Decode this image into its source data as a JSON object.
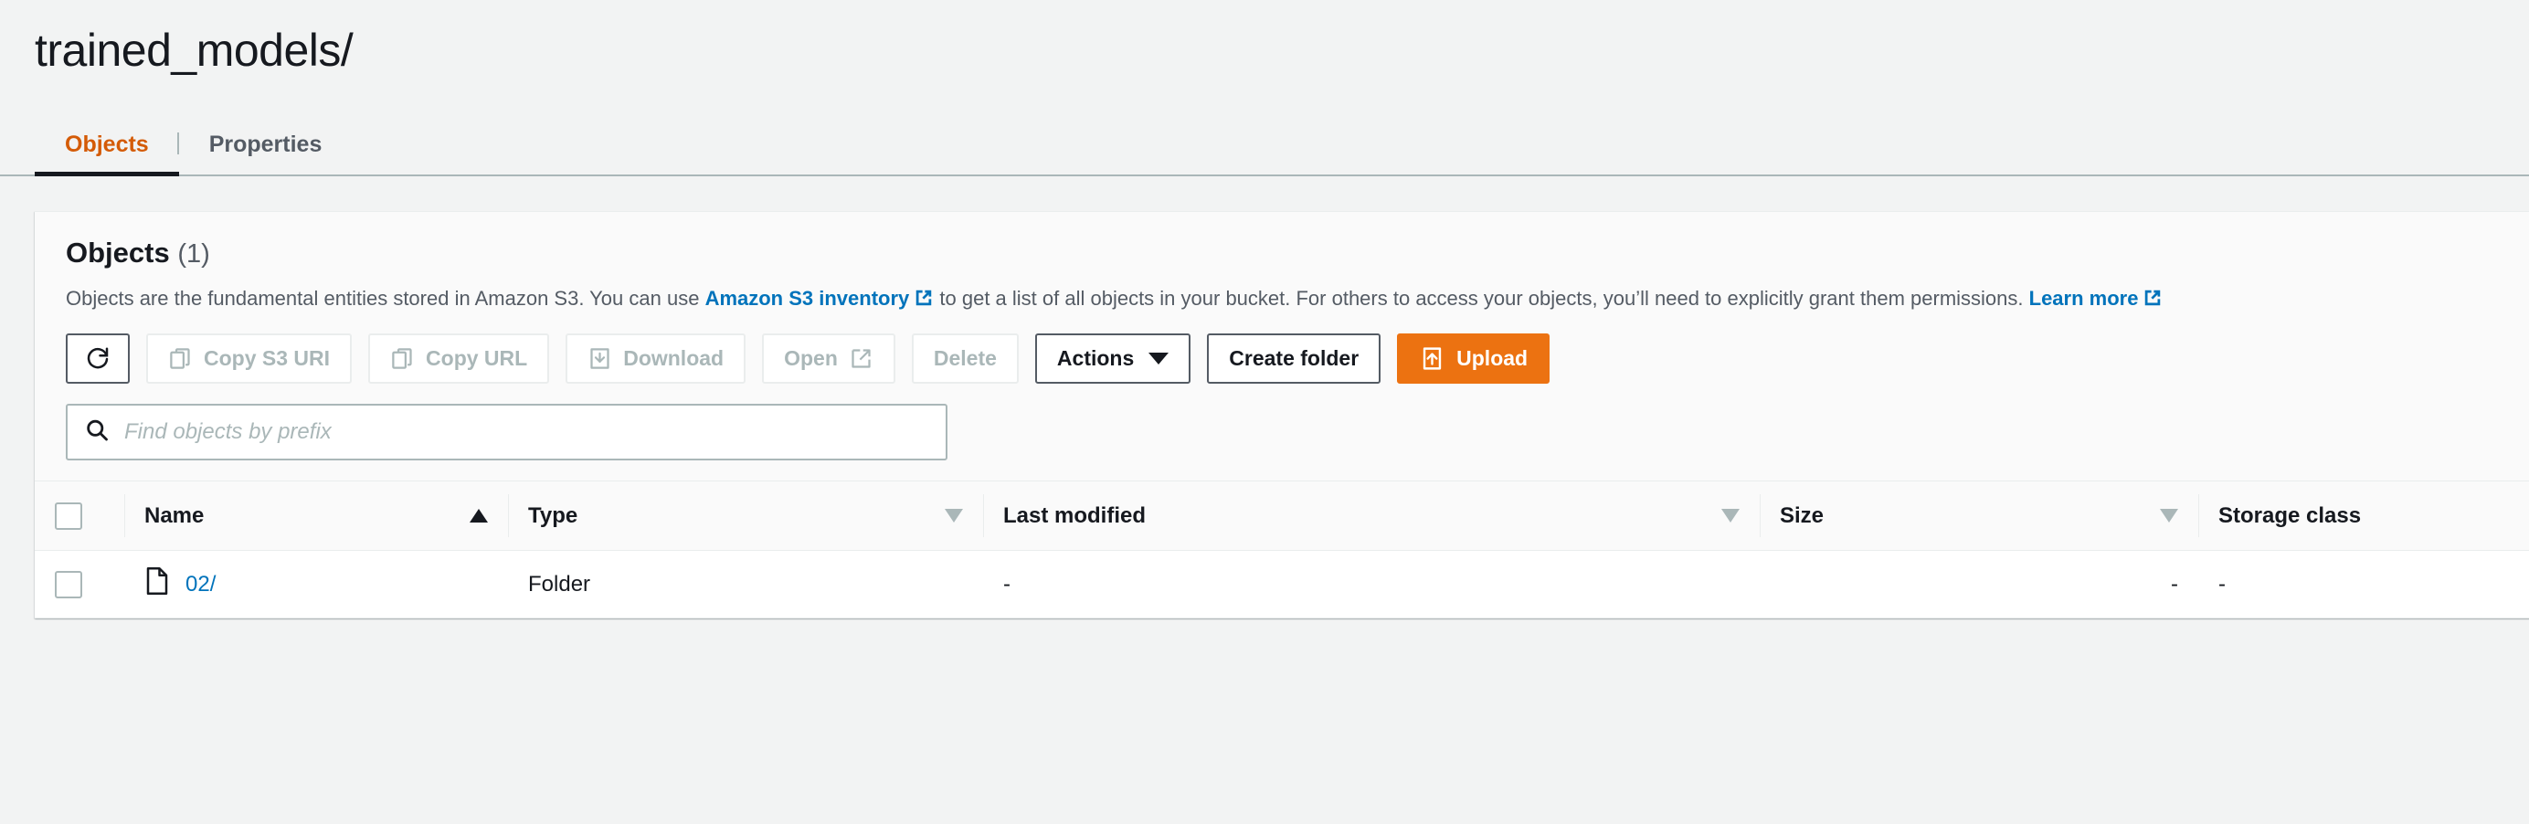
{
  "page": {
    "title": "trained_models/"
  },
  "tabs": [
    {
      "label": "Objects",
      "active": true
    },
    {
      "label": "Properties",
      "active": false
    }
  ],
  "objects_card": {
    "heading": "Objects",
    "count": "(1)",
    "description": {
      "part1": "Objects are the fundamental entities stored in Amazon S3. You can use ",
      "link1": "Amazon S3 inventory",
      "part2": " to get a list of all objects in your bucket. For others to access your objects, you’ll need to explicitly grant them permissions. ",
      "link2": "Learn more"
    },
    "toolbar": {
      "refresh": {
        "icon": "refresh-icon",
        "label": "",
        "disabled": false
      },
      "buttons": [
        {
          "name": "copy-s3-uri-button",
          "label": "Copy S3 URI",
          "icon": "copy-icon",
          "disabled": true
        },
        {
          "name": "copy-url-button",
          "label": "Copy URL",
          "icon": "copy-icon",
          "disabled": true
        },
        {
          "name": "download-button",
          "label": "Download",
          "icon": "download-icon",
          "disabled": true
        },
        {
          "name": "open-button",
          "label": "Open",
          "icon": "external-link-icon",
          "disabled": true
        },
        {
          "name": "delete-button",
          "label": "Delete",
          "icon": "",
          "disabled": true
        },
        {
          "name": "actions-button",
          "label": "Actions",
          "icon": "chevron-down-icon",
          "disabled": false
        },
        {
          "name": "create-folder-button",
          "label": "Create folder",
          "icon": "",
          "disabled": false
        },
        {
          "name": "upload-button",
          "label": "Upload",
          "icon": "upload-icon",
          "disabled": false,
          "primary": true
        }
      ]
    },
    "search": {
      "placeholder": "Find objects by prefix",
      "value": ""
    },
    "table": {
      "columns": [
        {
          "label": "Name",
          "sort": "asc"
        },
        {
          "label": "Type",
          "sort": "idle"
        },
        {
          "label": "Last modified",
          "sort": "idle"
        },
        {
          "label": "Size",
          "sort": "idle"
        },
        {
          "label": "Storage class",
          "sort": "none"
        }
      ],
      "rows": [
        {
          "name": "02/",
          "icon": "folder-icon",
          "type": "Folder",
          "last_modified": "-",
          "size": "-",
          "storage_class": "-"
        }
      ]
    }
  },
  "colors": {
    "accent_orange": "#ec7211",
    "tab_active": "#d45b07",
    "link_blue": "#0073bb",
    "page_background": "#f2f3f3",
    "text_primary": "#16191f",
    "text_secondary": "#545b64",
    "border": "#eaeded"
  }
}
